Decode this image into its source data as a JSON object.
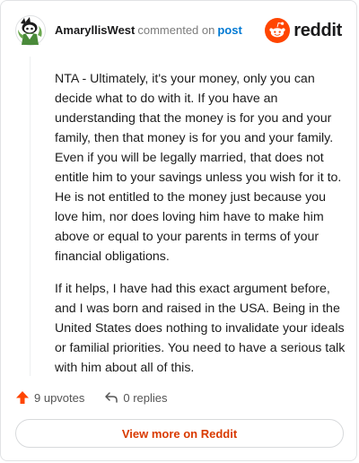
{
  "comment": {
    "author": "AmaryllisWest",
    "verb": "commented on",
    "post_link": "post",
    "paragraphs": [
      "NTA - Ultimately, it's your money, only you can decide what to do with it. If you have an understanding that the money is for you and your family, then that money is for you and your family. Even if you will be legally married, that does not entitle him to your savings unless you wish for it to. He is not entitled to the money just because you love him, nor does loving him have to make him above or equal to your parents in terms of your financial obligations.",
      "If it helps, I have had this exact argument before, and I was born and raised in the USA. Being in the United States does nothing to invalidate your ideals or familial priorities. You need to have a serious talk with him about all of this."
    ],
    "upvotes_label": "9 upvotes",
    "replies_label": "0 replies"
  },
  "brand": {
    "name": "reddit",
    "icon": "reddit-logo-icon",
    "color": "#ff4500"
  },
  "footer": {
    "view_more_label": "View more on Reddit",
    "accent": "#d93a00"
  }
}
